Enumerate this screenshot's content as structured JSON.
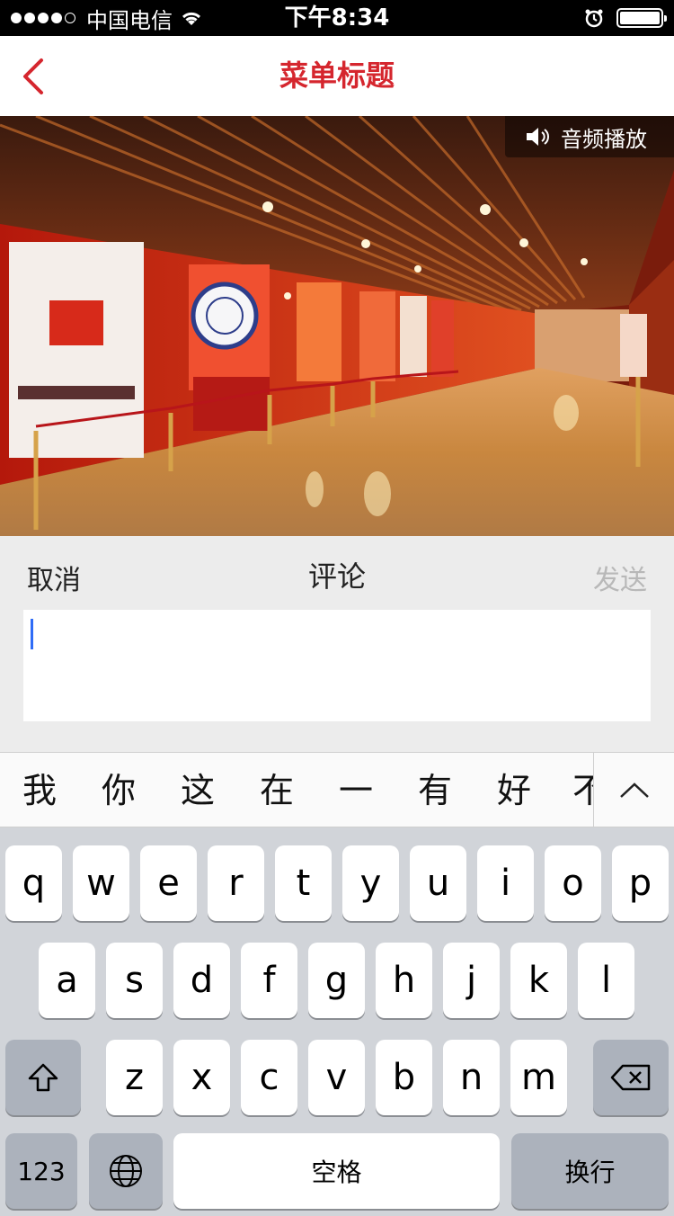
{
  "status_bar": {
    "carrier": "中国电信",
    "time": "下午8:34"
  },
  "nav": {
    "title": "菜单标题"
  },
  "hero": {
    "audio_label": "音频播放"
  },
  "comment": {
    "cancel_label": "取消",
    "title": "评论",
    "send_label": "发送",
    "input_value": ""
  },
  "candidates": [
    "我",
    "你",
    "这",
    "在",
    "一",
    "有",
    "好",
    "不"
  ],
  "keyboard": {
    "row1": [
      "q",
      "w",
      "e",
      "r",
      "t",
      "y",
      "u",
      "i",
      "o",
      "p"
    ],
    "row2": [
      "a",
      "s",
      "d",
      "f",
      "g",
      "h",
      "j",
      "k",
      "l"
    ],
    "row3": [
      "z",
      "x",
      "c",
      "v",
      "b",
      "n",
      "m"
    ],
    "numbers_label": "123",
    "space_label": "空格",
    "return_label": "换行"
  },
  "colors": {
    "accent": "#d5262e",
    "send_disabled": "#b8b8b8",
    "caret": "#2f6cf6"
  }
}
